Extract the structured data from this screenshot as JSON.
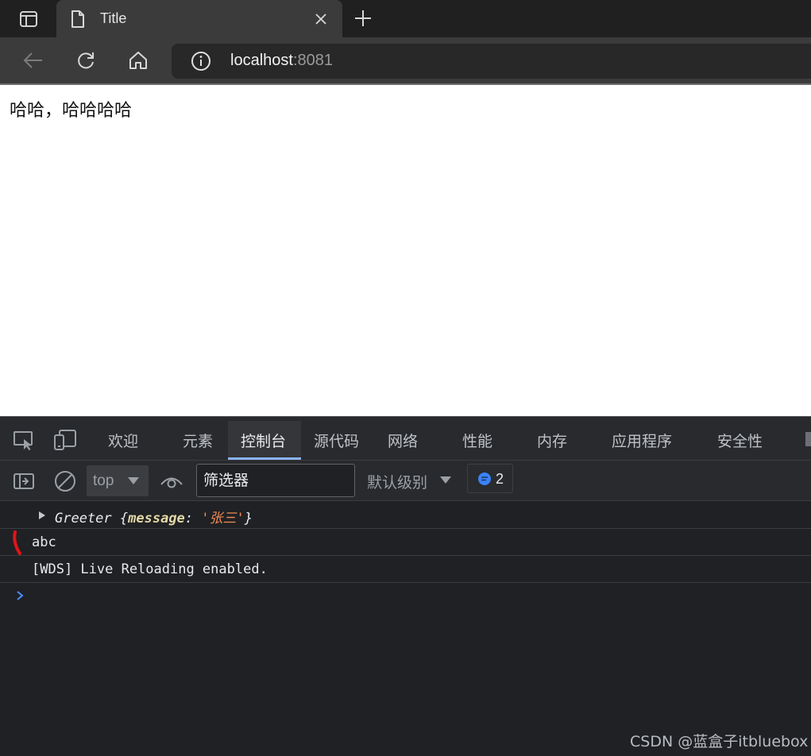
{
  "browser": {
    "tab": {
      "title": "Title"
    },
    "address": {
      "host": "localhost",
      "port": ":8081"
    }
  },
  "page": {
    "content_text": "哈哈，哈哈哈哈"
  },
  "devtools": {
    "tabs": [
      {
        "label": "欢迎"
      },
      {
        "label": "元素"
      },
      {
        "label": "控制台",
        "active": true
      },
      {
        "label": "源代码"
      },
      {
        "label": "网络"
      },
      {
        "label": "性能"
      },
      {
        "label": "内存"
      },
      {
        "label": "应用程序"
      },
      {
        "label": "安全性"
      }
    ],
    "console_toolbar": {
      "context": "top",
      "filter_placeholder": "筛选器",
      "levels_label": "默认级别",
      "message_count": "2"
    },
    "console": {
      "object_entry": {
        "class_name": "Greeter",
        "key": "message",
        "value": "'张三'"
      },
      "abc_entry": "abc",
      "wds_entry": "[WDS] Live Reloading enabled."
    }
  },
  "watermark": "CSDN @蓝盒子itbluebox",
  "colors": {
    "devtools_bg": "#202124",
    "active_tab_accent": "#8ab4f8",
    "string_value": "#f28b54",
    "prompt_caret": "#4a90ff",
    "annotation_mark": "#e0141b"
  }
}
